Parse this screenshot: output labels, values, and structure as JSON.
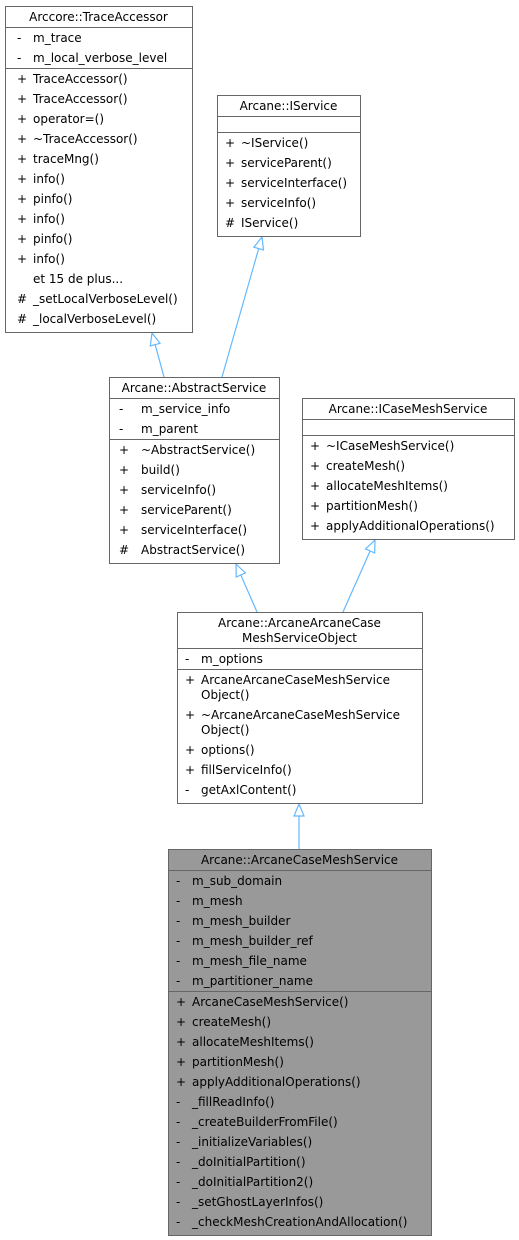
{
  "diagram": {
    "type": "class-inheritance",
    "colors": {
      "box_fill": "#ffffff",
      "focus_fill": "#999999",
      "border": "#666666",
      "edge": "#63b8ff"
    },
    "classes": [
      {
        "id": "trace_accessor",
        "title": [
          "Arccore::TraceAccessor"
        ],
        "attributes": [
          {
            "vis": "-",
            "name": "m_trace"
          },
          {
            "vis": "-",
            "name": "m_local_verbose_level"
          }
        ],
        "methods": [
          {
            "vis": "+",
            "name": "TraceAccessor()"
          },
          {
            "vis": "+",
            "name": "TraceAccessor()"
          },
          {
            "vis": "+",
            "name": "operator=()"
          },
          {
            "vis": "+",
            "name": "~TraceAccessor()"
          },
          {
            "vis": "+",
            "name": "traceMng()"
          },
          {
            "vis": "+",
            "name": "info()"
          },
          {
            "vis": "+",
            "name": "pinfo()"
          },
          {
            "vis": "+",
            "name": "info()"
          },
          {
            "vis": "+",
            "name": "pinfo()"
          },
          {
            "vis": "+",
            "name": "info()"
          },
          {
            "vis": "",
            "name": "et 15 de plus..."
          },
          {
            "vis": "#",
            "name": "_setLocalVerboseLevel()"
          },
          {
            "vis": "#",
            "name": "_localVerboseLevel()"
          }
        ]
      },
      {
        "id": "iservice",
        "title": [
          "Arcane::IService"
        ],
        "attributes": [],
        "methods": [
          {
            "vis": "+",
            "name": "~IService()"
          },
          {
            "vis": "+",
            "name": "serviceParent()"
          },
          {
            "vis": "+",
            "name": "serviceInterface()"
          },
          {
            "vis": "+",
            "name": "serviceInfo()"
          },
          {
            "vis": "#",
            "name": "IService()"
          }
        ]
      },
      {
        "id": "abstract_service",
        "title": [
          "Arcane::AbstractService"
        ],
        "attributes": [
          {
            "vis": "-",
            "name": "m_service_info"
          },
          {
            "vis": "-",
            "name": "m_parent"
          }
        ],
        "methods": [
          {
            "vis": "+",
            "name": "~AbstractService()"
          },
          {
            "vis": "+",
            "name": "build()"
          },
          {
            "vis": "+",
            "name": "serviceInfo()"
          },
          {
            "vis": "+",
            "name": "serviceParent()"
          },
          {
            "vis": "+",
            "name": "serviceInterface()"
          },
          {
            "vis": "#",
            "name": "AbstractService()"
          }
        ]
      },
      {
        "id": "icase_mesh_service",
        "title": [
          "Arcane::ICaseMeshService"
        ],
        "attributes": [],
        "methods": [
          {
            "vis": "+",
            "name": "~ICaseMeshService()"
          },
          {
            "vis": "+",
            "name": "createMesh()"
          },
          {
            "vis": "+",
            "name": "allocateMeshItems()"
          },
          {
            "vis": "+",
            "name": "partitionMesh()"
          },
          {
            "vis": "+",
            "name": "applyAdditionalOperations()"
          }
        ]
      },
      {
        "id": "service_object",
        "title": [
          "Arcane::ArcaneArcaneCase",
          "MeshServiceObject"
        ],
        "attributes": [
          {
            "vis": "-",
            "name": "m_options"
          }
        ],
        "methods": [
          {
            "vis": "+",
            "name": "ArcaneArcaneCaseMeshService",
            "cont": "Object()"
          },
          {
            "vis": "+",
            "name": "~ArcaneArcaneCaseMeshService",
            "cont": "Object()"
          },
          {
            "vis": "+",
            "name": "options()"
          },
          {
            "vis": "+",
            "name": "fillServiceInfo()"
          },
          {
            "vis": "-",
            "name": "getAxlContent()"
          }
        ]
      },
      {
        "id": "case_mesh_service",
        "title": [
          "Arcane::ArcaneCaseMeshService"
        ],
        "focus": true,
        "attributes": [
          {
            "vis": "-",
            "name": "m_sub_domain"
          },
          {
            "vis": "-",
            "name": "m_mesh"
          },
          {
            "vis": "-",
            "name": "m_mesh_builder"
          },
          {
            "vis": "-",
            "name": "m_mesh_builder_ref"
          },
          {
            "vis": "-",
            "name": "m_mesh_file_name"
          },
          {
            "vis": "-",
            "name": "m_partitioner_name"
          }
        ],
        "methods": [
          {
            "vis": "+",
            "name": "ArcaneCaseMeshService()"
          },
          {
            "vis": "+",
            "name": "createMesh()"
          },
          {
            "vis": "+",
            "name": "allocateMeshItems()"
          },
          {
            "vis": "+",
            "name": "partitionMesh()"
          },
          {
            "vis": "+",
            "name": "applyAdditionalOperations()"
          },
          {
            "vis": "-",
            "name": "_fillReadInfo()"
          },
          {
            "vis": "-",
            "name": "_createBuilderFromFile()"
          },
          {
            "vis": "-",
            "name": "_initializeVariables()"
          },
          {
            "vis": "-",
            "name": "_doInitialPartition()"
          },
          {
            "vis": "-",
            "name": "_doInitialPartition2()"
          },
          {
            "vis": "-",
            "name": "_setGhostLayerInfos()"
          },
          {
            "vis": "-",
            "name": "_checkMeshCreationAndAllocation()"
          }
        ]
      }
    ],
    "edges": [
      {
        "from": "abstract_service",
        "to": "trace_accessor",
        "kind": "inherits"
      },
      {
        "from": "abstract_service",
        "to": "iservice",
        "kind": "inherits"
      },
      {
        "from": "service_object",
        "to": "abstract_service",
        "kind": "inherits"
      },
      {
        "from": "service_object",
        "to": "icase_mesh_service",
        "kind": "inherits"
      },
      {
        "from": "case_mesh_service",
        "to": "service_object",
        "kind": "inherits"
      }
    ]
  }
}
